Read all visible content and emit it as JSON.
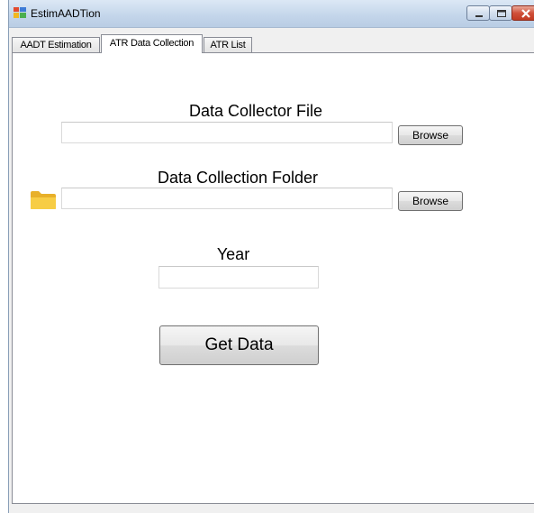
{
  "window": {
    "title": "EstimAADTion"
  },
  "tabs": [
    {
      "label": "AADT Estimation",
      "selected": false
    },
    {
      "label": "ATR Data Collection",
      "selected": true
    },
    {
      "label": "ATR List",
      "selected": false
    }
  ],
  "atr_data_collection": {
    "data_collector_file": {
      "label": "Data Collector File",
      "value": "",
      "browse_label": "Browse"
    },
    "data_collection_folder": {
      "label": "Data Collection Folder",
      "value": "",
      "browse_label": "Browse",
      "icon": "folder-icon",
      "icon_color": "#f5c542"
    },
    "year": {
      "label": "Year",
      "value": ""
    },
    "get_data_label": "Get Data"
  },
  "colors": {
    "tab_page_background": "#ffffff",
    "window_frame": "#f0f0f0",
    "close_button": "#c94a33"
  }
}
